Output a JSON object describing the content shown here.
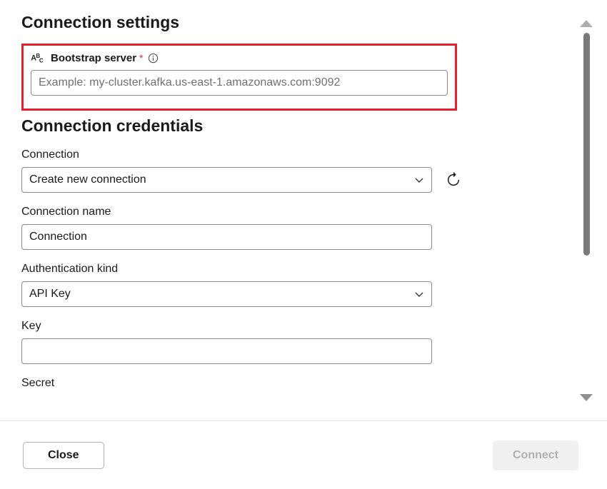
{
  "settings": {
    "heading": "Connection settings",
    "bootstrap": {
      "label": "Bootstrap server",
      "required_mark": "*",
      "placeholder": "Example: my-cluster.kafka.us-east-1.amazonaws.com:9092",
      "value": ""
    }
  },
  "credentials": {
    "heading": "Connection credentials",
    "connection": {
      "label": "Connection",
      "value": "Create new connection"
    },
    "connection_name": {
      "label": "Connection name",
      "value": "Connection"
    },
    "auth_kind": {
      "label": "Authentication kind",
      "value": "API Key"
    },
    "key": {
      "label": "Key",
      "value": ""
    },
    "secret": {
      "label": "Secret",
      "value": ""
    }
  },
  "footer": {
    "close": "Close",
    "connect": "Connect"
  }
}
